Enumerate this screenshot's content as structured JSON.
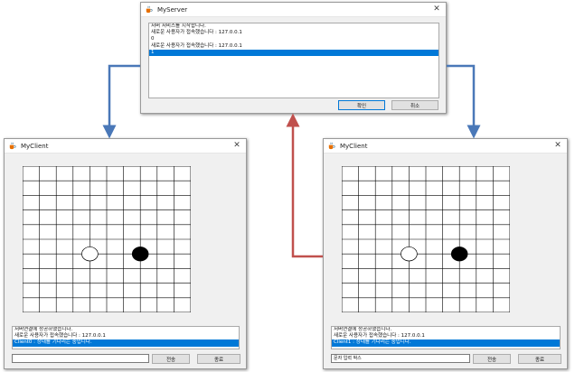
{
  "server": {
    "title": "MyServer",
    "log_lines": [
      "서버 서비스를 시작합니다.",
      "새로운 사용자가 접속했습니다 : 127.0.0.1",
      "0",
      "새로운 사용자가 접속했습니다 : 127.0.0.1",
      "1"
    ],
    "selected_line": 4,
    "ok_label": "확인",
    "cancel_label": "취소"
  },
  "client_left": {
    "title": "MyClient",
    "log_lines": [
      "서버연결에 성공하였습니다.",
      "새로운 사용자가 접속했습니다 : 127.0.0.1",
      "Client0 : 상대를 기다리는 중입니다."
    ],
    "selected_line": 2,
    "input_value": "",
    "input_placeholder": "",
    "send_label": "전송",
    "quit_label": "종료"
  },
  "client_right": {
    "title": "MyClient",
    "log_lines": [
      "서버연결에 성공하였습니다.",
      "새로운 사용자가 접속했습니다 : 127.0.0.1",
      "Client1 : 상대를 기다리는 중입니다."
    ],
    "selected_line": 2,
    "input_value": "문자 입력 박스",
    "input_placeholder": "",
    "send_label": "전송",
    "quit_label": "종료"
  },
  "board": {
    "lines": 10,
    "stones": [
      {
        "col": 4,
        "row": 6,
        "color": "white"
      },
      {
        "col": 7,
        "row": 6,
        "color": "black"
      }
    ]
  },
  "colors": {
    "selection": "#0078d7",
    "arrow_blue": "#4a78b8",
    "arrow_red": "#c0504d"
  },
  "icons": {
    "app": "java-coffee-cup-icon",
    "close": "close-x-icon"
  }
}
